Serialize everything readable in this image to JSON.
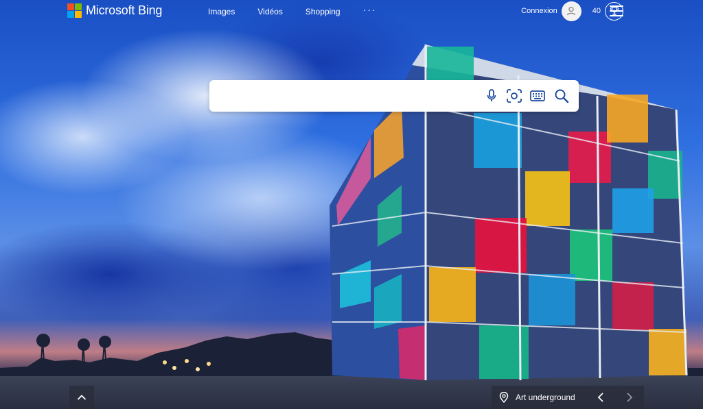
{
  "brand": {
    "name": "Microsoft Bing",
    "logo_colors": [
      "#f25022",
      "#7fba00",
      "#00a4ef",
      "#ffb900"
    ]
  },
  "nav": {
    "items": [
      "Images",
      "Vidéos",
      "Shopping"
    ],
    "more_label": "···"
  },
  "account": {
    "signin_label": "Connexion",
    "rewards_points": "40"
  },
  "search": {
    "value": "",
    "placeholder": "",
    "icons": [
      "microphone-icon",
      "visual-search-icon",
      "keyboard-icon",
      "search-icon"
    ]
  },
  "image_of_day": {
    "title": "Art underground"
  },
  "colors": {
    "header_text": "#ffffff",
    "search_icon": "#1b4a9e",
    "bottom_bar": "#282c3a"
  }
}
